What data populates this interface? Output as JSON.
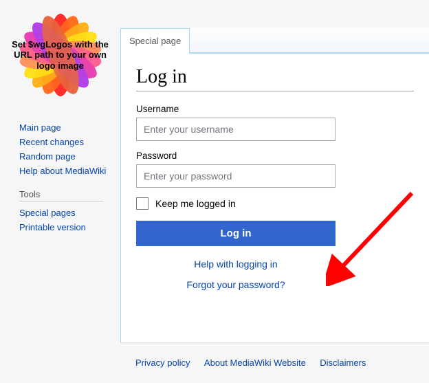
{
  "logo": {
    "text": "Set $wgLogos with the URL path to your own logo image"
  },
  "sidebar": {
    "nav_items": [
      {
        "label": "Main page"
      },
      {
        "label": "Recent changes"
      },
      {
        "label": "Random page"
      },
      {
        "label": "Help about MediaWiki"
      }
    ],
    "tools_heading": "Tools",
    "tools_items": [
      {
        "label": "Special pages"
      },
      {
        "label": "Printable version"
      }
    ]
  },
  "tab": {
    "label": "Special page"
  },
  "page": {
    "title": "Log in"
  },
  "form": {
    "username_label": "Username",
    "username_placeholder": "Enter your username",
    "password_label": "Password",
    "password_placeholder": "Enter your password",
    "keep_logged_in": "Keep me logged in",
    "submit_label": "Log in",
    "help_link": "Help with logging in",
    "forgot_link": "Forgot your password?"
  },
  "footer": {
    "privacy": "Privacy policy",
    "about": "About MediaWiki Website",
    "disclaimers": "Disclaimers"
  }
}
